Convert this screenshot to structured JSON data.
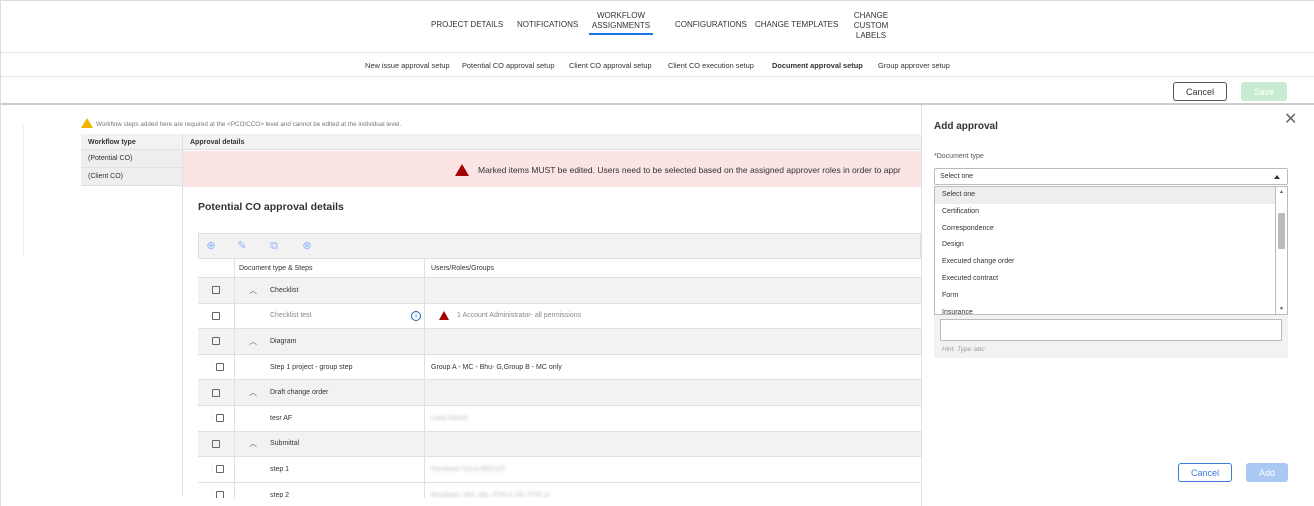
{
  "topnav": {
    "items": [
      "PROJECT DETAILS",
      "NOTIFICATIONS",
      "WORKFLOW",
      "ASSIGNMENTS",
      "CONFIGURATIONS",
      "CHANGE TEMPLATES",
      "CHANGE CUSTOM",
      "LABELS"
    ]
  },
  "subnav": {
    "items": [
      "New issue approval setup",
      "Potential CO approval setup",
      "Client CO approval setup",
      "Client CO execution setup",
      "Document approval setup",
      "Group approver setup"
    ]
  },
  "actions": {
    "cancel": "Cancel",
    "save": "Save"
  },
  "warning": "Workflow steps added here are required at the <PCO/CCO> level and cannot be edited at the individual level.",
  "workflow": {
    "header": "Workflow type",
    "types": [
      "(Potential CO)",
      "(Client CO)"
    ]
  },
  "approval": {
    "header": "Approval details",
    "error": "Marked items MUST be edited. Users need to be selected based on the assigned approver roles in order to appr",
    "section_title": "Potential CO approval details",
    "columns": [
      "Document type & Steps",
      "Users/Roles/Groups"
    ],
    "rows": [
      {
        "type": "group",
        "label": "Checklist"
      },
      {
        "type": "step",
        "label": "Checklist test",
        "users": "1 Account Administrator- all permissions",
        "error": true,
        "info": true,
        "muted": true
      },
      {
        "type": "group",
        "label": "Diagram"
      },
      {
        "type": "step",
        "label": "Step 1 project - group step",
        "users": "Group A - MC - Bhu- G,Group B - MC only",
        "drag": true
      },
      {
        "type": "group",
        "label": "Draft change order"
      },
      {
        "type": "step",
        "label": "tesr AF",
        "users": "Lead Admin",
        "drag": true,
        "blur": true
      },
      {
        "type": "group",
        "label": "Submittal"
      },
      {
        "type": "step",
        "label": "step 1",
        "users": "Reviewer Cona MGUST",
        "drag": true,
        "blur": true
      },
      {
        "type": "step",
        "label": "step 2",
        "users": "Reviewer, MG, Mo, PTR e, Mt, PTR at",
        "drag": true,
        "blur": true
      }
    ]
  },
  "panel": {
    "title": "Add approval",
    "field_label": "*Document type",
    "selected": "Select one",
    "options": [
      "Select one",
      "Certification",
      "Correspondence",
      "Design",
      "Executed change order",
      "Executed contract",
      "Form",
      "Insurance"
    ],
    "hint": "Hint: Type 'abc'",
    "cancel": "Cancel",
    "add": "Add"
  },
  "colors": {
    "accent": "#1a73e8",
    "error": "#a40000",
    "error_bg": "#fce4e4",
    "save_disabled": "#c8ebd1",
    "add_disabled": "#a9c8f4"
  }
}
